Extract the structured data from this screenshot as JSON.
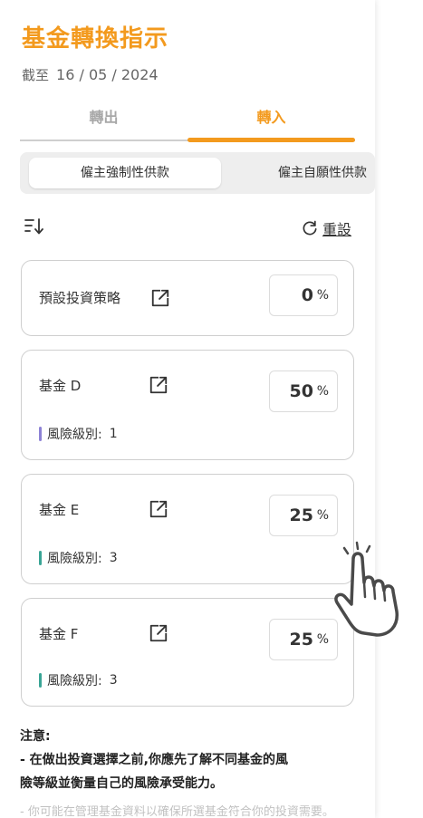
{
  "header": {
    "title": "基金轉換指示",
    "as_of_label": "截至",
    "as_of_date": "16 / 05 / 2024"
  },
  "tabs": [
    {
      "label": "轉出",
      "active": false
    },
    {
      "label": "轉入",
      "active": true
    }
  ],
  "subtabs": [
    {
      "label": "僱主強制性供款",
      "active": true
    },
    {
      "label": "僱主自願性供款",
      "active": false
    }
  ],
  "toolbar": {
    "reset_label": "重設",
    "sort_icon": "sort-icon",
    "reset_icon": "refresh-icon"
  },
  "funds": [
    {
      "name": "預設投資策略",
      "percent": "0",
      "percent_sign": "%",
      "risk_label": "",
      "risk_level": ""
    },
    {
      "name": "基金 D",
      "percent": "50",
      "percent_sign": "%",
      "risk_label": "風險級別:",
      "risk_level": "1",
      "risk_color": "#8d82d6"
    },
    {
      "name": "基金 E",
      "percent": "25",
      "percent_sign": "%",
      "risk_label": "風險級別:",
      "risk_level": "3",
      "risk_color": "#3aa596"
    },
    {
      "name": "基金 F",
      "percent": "25",
      "percent_sign": "%",
      "risk_label": "風險級別:",
      "risk_level": "3",
      "risk_color": "#3aa596"
    }
  ],
  "notes": {
    "heading": "注意:",
    "line1": "- 在做出投資選擇之前,你應先了解不同基金的風",
    "line2": "險等級並衡量自己的風險承受能力。",
    "line3": "- 你可能在管理基金資料以確保所選基金符合你的投資需要。"
  },
  "colors": {
    "accent": "#f39a1e",
    "risk_low": "#8d82d6",
    "risk_mid": "#3aa596"
  }
}
